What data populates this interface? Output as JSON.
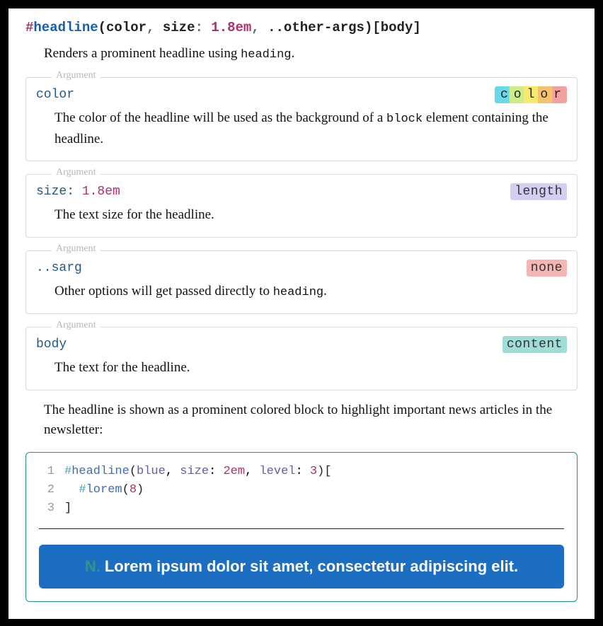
{
  "signature": {
    "hash": "#",
    "name": "headline",
    "open": "(",
    "arg1": "color",
    "sep1": ", ",
    "arg2key": "size",
    "arg2sep": ": ",
    "arg2val": "1.8em",
    "sep2": ", ",
    "sink": "..other-args",
    "close": ")",
    "open_bracket": "[",
    "body": "body",
    "close_bracket": "]"
  },
  "intro": {
    "pre": "Renders a prominent headline using ",
    "code": "heading",
    "post": "."
  },
  "argLabel": "Argument",
  "args": [
    {
      "name_html": "color",
      "kw": "",
      "kwval": "",
      "type_text": "color",
      "type_class": "type-rainbow",
      "desc_pre": "The color of the headline will be used as the background of a ",
      "desc_code": "block",
      "desc_post": " element containing the headline."
    },
    {
      "name_html": "size",
      "kw": ": ",
      "kwval": "1.8em",
      "type_text": "length",
      "type_class": "type-length",
      "desc_pre": "The text size for the headline.",
      "desc_code": "",
      "desc_post": ""
    },
    {
      "name_html": "..sarg",
      "kw": "",
      "kwval": "",
      "type_text": "none",
      "type_class": "type-none",
      "desc_pre": "Other options will get passed directly to ",
      "desc_code": "heading",
      "desc_post": "."
    },
    {
      "name_html": "body",
      "kw": "",
      "kwval": "",
      "type_text": "content",
      "type_class": "type-content",
      "desc_pre": "The text for the headline.",
      "desc_code": "",
      "desc_post": ""
    }
  ],
  "explain": "The headline is shown as a prominent colored block to highlight important news articles in the newsletter:",
  "code": {
    "l1": {
      "n": "1",
      "hash": "#",
      "fn": "headline",
      "open": "(",
      "arg1": "blue",
      "sep1": ", ",
      "kw1": "size",
      "kws1": ": ",
      "val1": "2em",
      "sep2": ", ",
      "kw2": "level",
      "kws2": ": ",
      "val2": "3",
      "close": ")",
      "br": "["
    },
    "l2": {
      "n": "2",
      "indent": "  ",
      "hash": "#",
      "fn": "lorem",
      "open": "(",
      "val": "8",
      "close": ")"
    },
    "l3": {
      "n": "3",
      "br": "]"
    }
  },
  "preview": {
    "num": "N.",
    "text": "Lorem ipsum dolor sit amet, consectetur adipiscing elit."
  }
}
